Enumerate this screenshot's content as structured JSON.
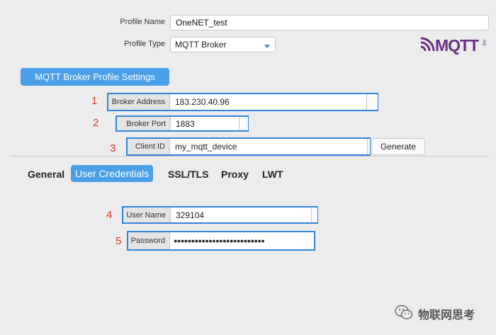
{
  "profile": {
    "name_label": "Profile Name",
    "name_value": "OneNET_test",
    "type_label": "Profile Type",
    "type_value": "MQTT Broker"
  },
  "logo": {
    "text": "MQTT",
    "sub": ".org"
  },
  "section_title": "MQTT Broker Profile Settings",
  "broker": {
    "address_num": "1",
    "address_label": "Broker Address",
    "address_value": "183.230.40.96",
    "port_num": "2",
    "port_label": "Broker Port",
    "port_value": "1883",
    "client_num": "3",
    "client_label": "Client ID",
    "client_value": "my_mqtt_device",
    "generate_label": "Generate"
  },
  "tabs": [
    "General",
    "User Credentials",
    "SSL/TLS",
    "Proxy",
    "LWT"
  ],
  "active_tab_index": 1,
  "credentials": {
    "user_num": "4",
    "user_label": "User Name",
    "user_value": "329104",
    "pass_num": "5",
    "pass_label": "Password",
    "pass_value": "●●●●●●●●●●●●●●●●●●●●●●●●●●"
  },
  "watermark": "物联网思考",
  "colors": {
    "accent": "#4a9fe6",
    "highlight": "#2f86d8",
    "marker": "#e0322b",
    "logo": "#6a2f82"
  }
}
